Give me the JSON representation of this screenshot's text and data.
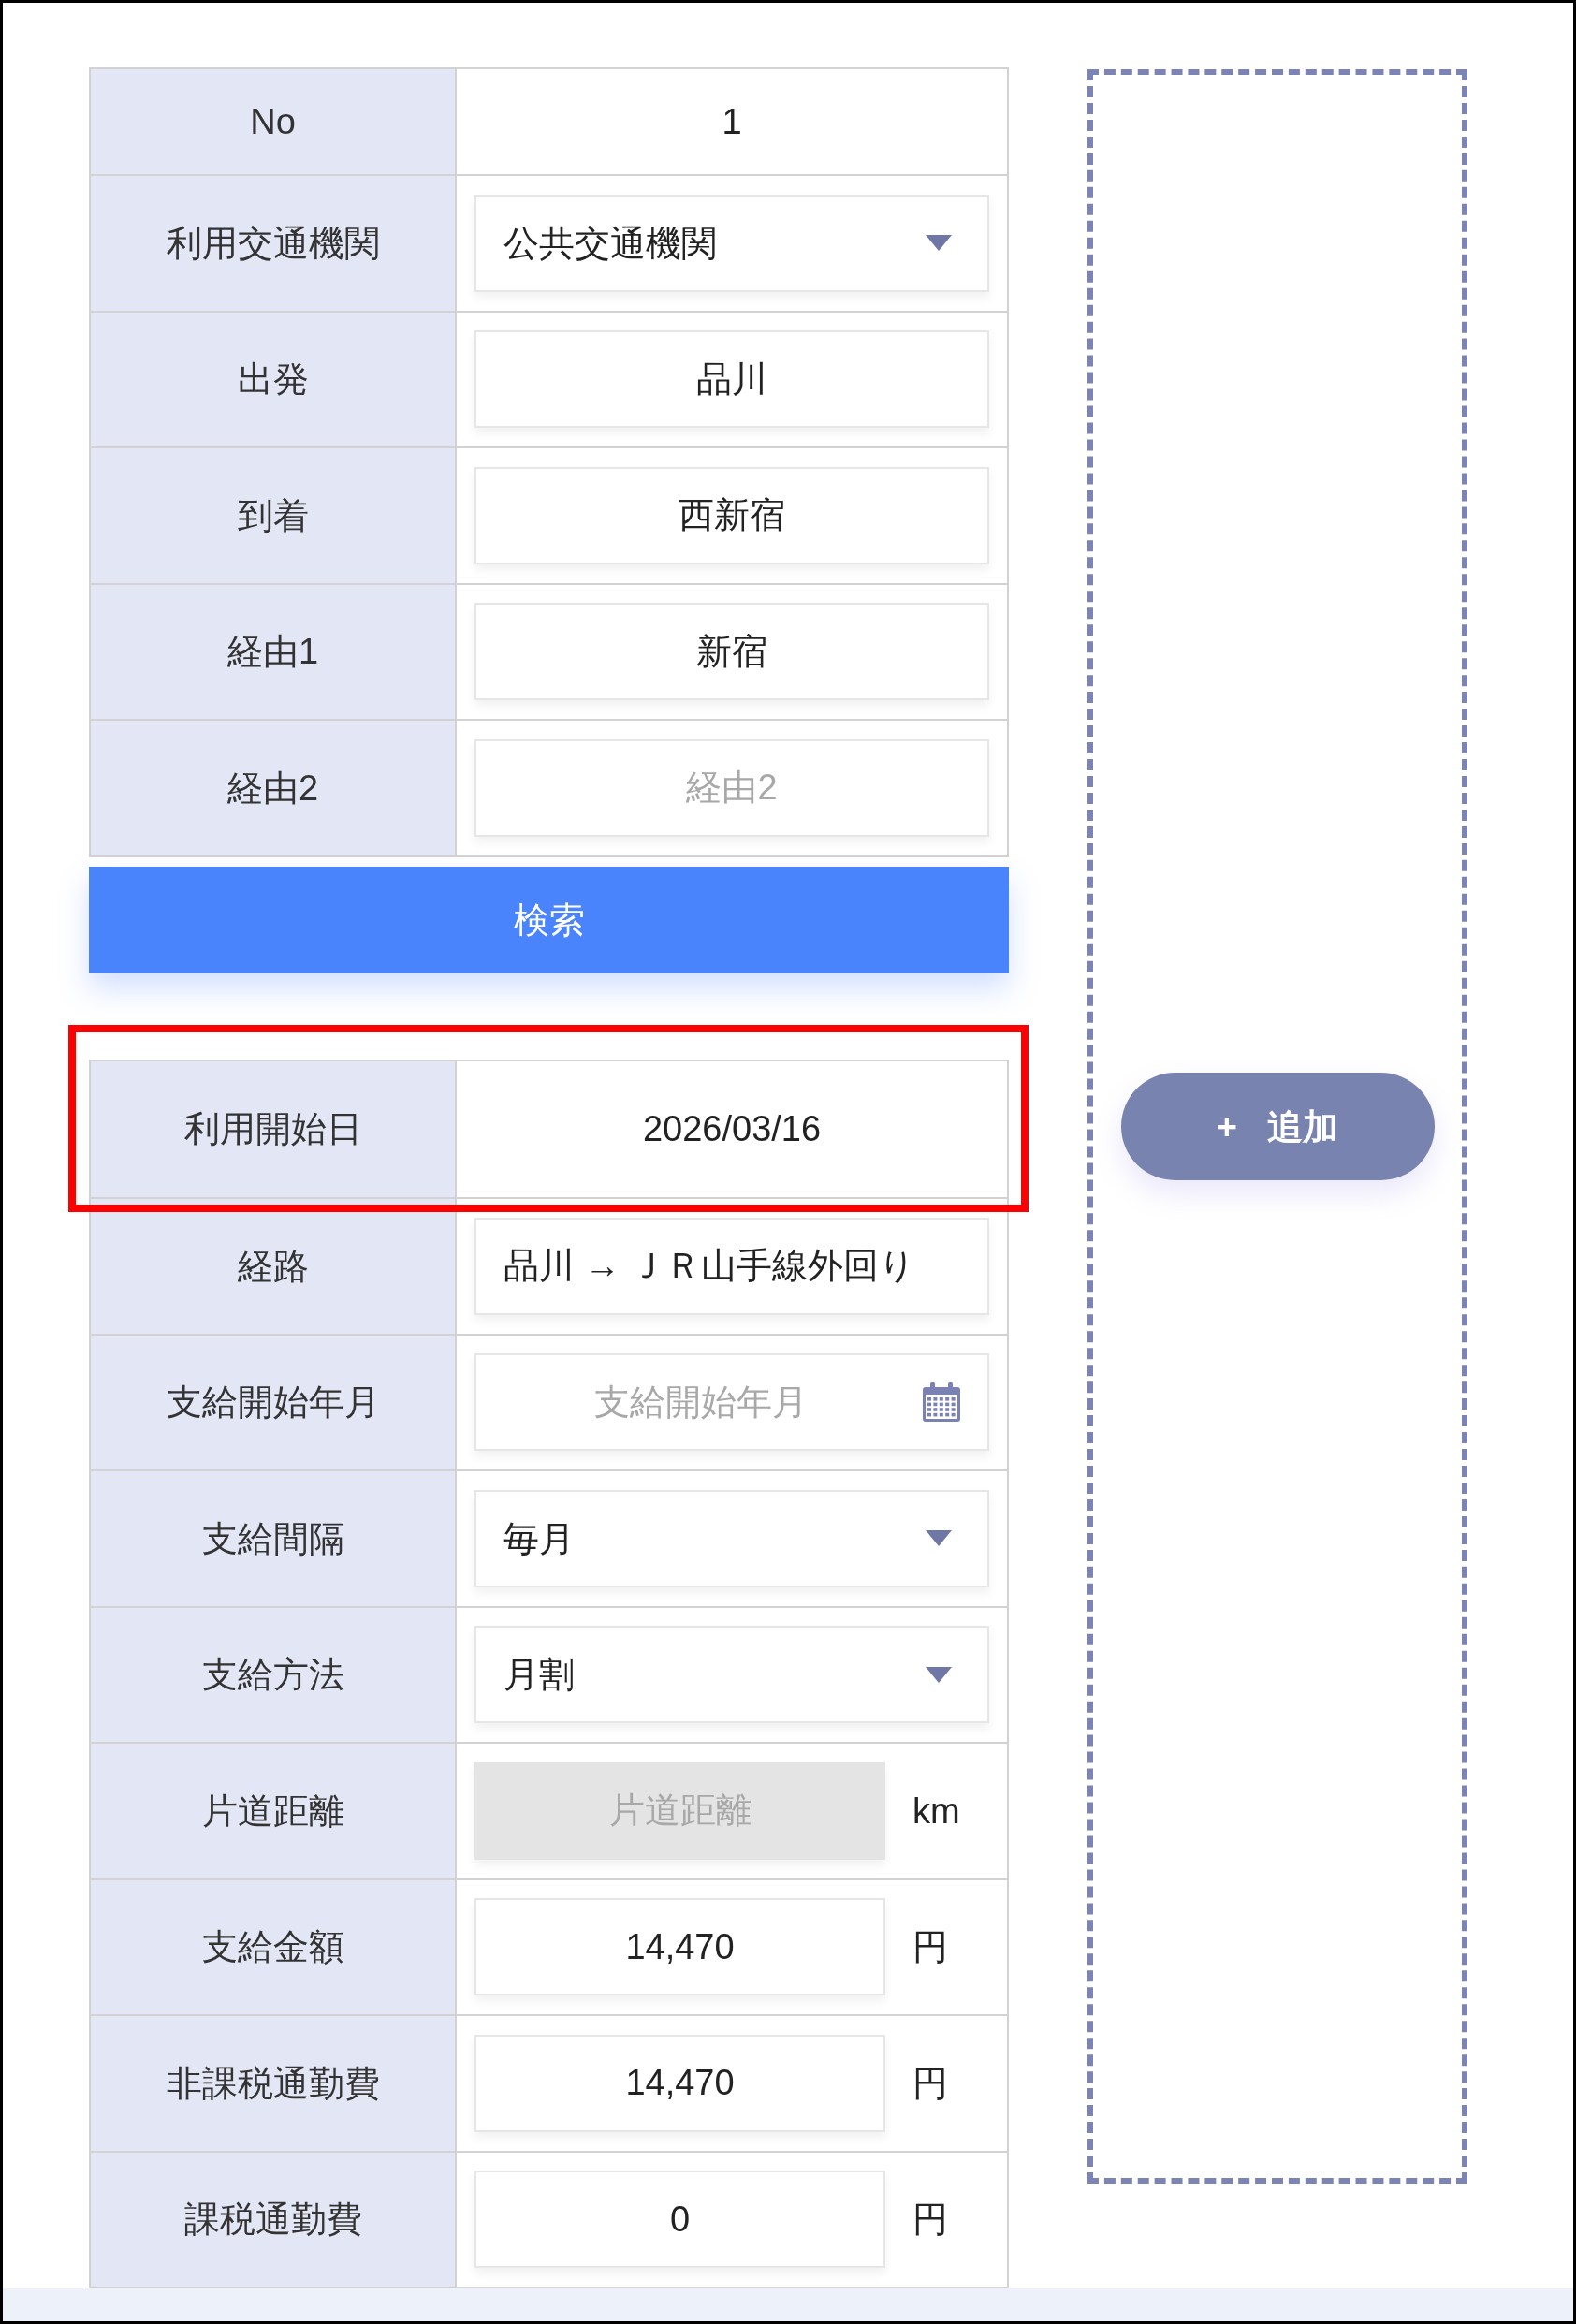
{
  "route_form": {
    "rows": [
      {
        "kind": "number",
        "label": "No",
        "value": "1"
      },
      {
        "kind": "select",
        "label": "利用交通機関",
        "value": "公共交通機関",
        "disabled": false
      },
      {
        "kind": "input",
        "label": "出発",
        "value": "品川",
        "disabled": false
      },
      {
        "kind": "input",
        "label": "到着",
        "value": "西新宿",
        "disabled": false
      },
      {
        "kind": "input",
        "label": "経由1",
        "value": "新宿",
        "disabled": false
      },
      {
        "kind": "input",
        "label": "経由2",
        "placeholder": "経由2",
        "disabled": false
      }
    ]
  },
  "search_button": {
    "label": "検索"
  },
  "commute_form": {
    "rows": [
      {
        "kind": "static",
        "label": "利用開始日",
        "value": "2026/03/16",
        "highlighted": true
      },
      {
        "kind": "route",
        "label": "経路",
        "value": "品川 → ＪＲ山手線外回り",
        "highlighted": false,
        "disabled": false
      },
      {
        "kind": "date",
        "label": "支給開始年月",
        "placeholder": "支給開始年月",
        "highlighted": false,
        "disabled": false
      },
      {
        "kind": "select",
        "label": "支給間隔",
        "value": "毎月",
        "highlighted": false,
        "disabled": false
      },
      {
        "kind": "select",
        "label": "支給方法",
        "value": "月割",
        "highlighted": false,
        "disabled": false
      },
      {
        "kind": "input",
        "label": "片道距離",
        "placeholder": "片道距離",
        "unit": "km",
        "highlighted": false,
        "disabled": true
      },
      {
        "kind": "input",
        "label": "支給金額",
        "value": "14,470",
        "unit": "円",
        "highlighted": false,
        "disabled": false
      },
      {
        "kind": "input",
        "label": "非課税通勤費",
        "value": "14,470",
        "unit": "円",
        "highlighted": false,
        "disabled": false
      },
      {
        "kind": "input",
        "label": "課税通勤費",
        "value": "0",
        "unit": "円",
        "highlighted": false,
        "disabled": false
      }
    ]
  },
  "add_button": {
    "label": "+ 追加"
  }
}
